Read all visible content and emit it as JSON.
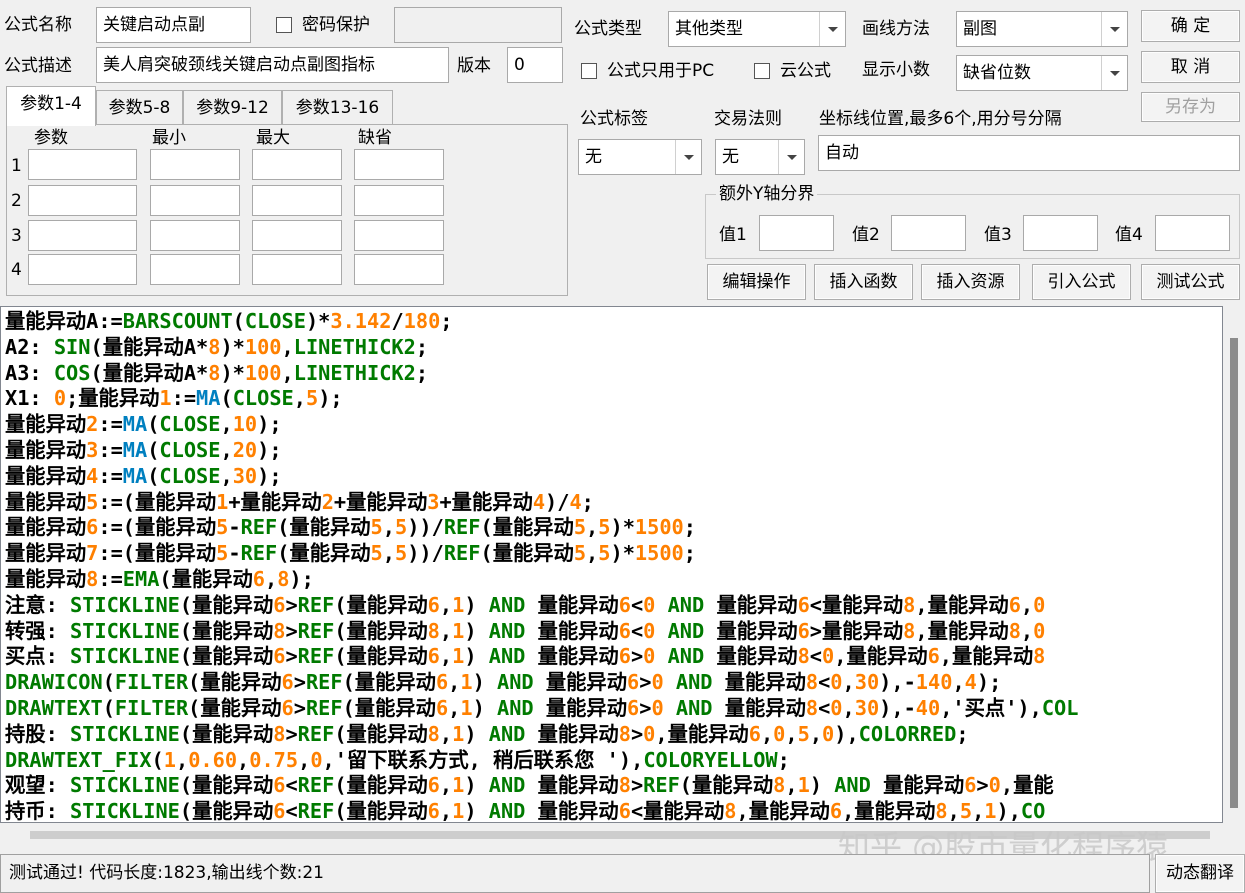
{
  "header": {
    "name_label": "公式名称",
    "name_value": "关键启动点副",
    "password_label": "密码保护",
    "password_value": "",
    "desc_label": "公式描述",
    "desc_value": "美人肩突破颈线关键启动点副图指标",
    "version_label": "版本",
    "version_value": "0",
    "type_label": "公式类型",
    "type_value": "其他类型",
    "draw_method_label": "画线方法",
    "draw_method_value": "副图",
    "pc_only_label": "公式只用于PC",
    "cloud_label": "云公式",
    "decimals_label": "显示小数",
    "decimals_value": "缺省位数"
  },
  "buttons": {
    "ok": "确  定",
    "cancel": "取  消",
    "save_as": "另存为",
    "edit_ops": "编辑操作",
    "insert_func": "插入函数",
    "insert_res": "插入资源",
    "import_formula": "引入公式",
    "test_formula": "测试公式",
    "dynamic_translate": "动态翻译"
  },
  "tabs": [
    "参数1-4",
    "参数5-8",
    "参数9-12",
    "参数13-16"
  ],
  "params": {
    "headers": [
      "参数",
      "最小",
      "最大",
      "缺省"
    ],
    "rows": [
      "1",
      "2",
      "3",
      "4"
    ]
  },
  "tags": {
    "formula_tag_label": "公式标签",
    "formula_tag_value": "无",
    "trade_rule_label": "交易法则",
    "trade_rule_value": "无",
    "coord_label": "坐标线位置,最多6个,用分号分隔",
    "coord_value": "自动"
  },
  "yaxis": {
    "group_label": "额外Y轴分界",
    "v1": "值1",
    "v2": "值2",
    "v3": "值3",
    "v4": "值4"
  },
  "code_lines": [
    "量能异动A:=BARSCOUNT(CLOSE)*3.142/180;",
    "A2: SIN(量能异动A*8)*100,LINETHICK2;",
    "A3: COS(量能异动A*8)*100,LINETHICK2;",
    "X1: 0;量能异动1:=MA(CLOSE,5);",
    "量能异动2:=MA(CLOSE,10);",
    "量能异动3:=MA(CLOSE,20);",
    "量能异动4:=MA(CLOSE,30);",
    "量能异动5:=(量能异动1+量能异动2+量能异动3+量能异动4)/4;",
    "量能异动6:=(量能异动5-REF(量能异动5,5))/REF(量能异动5,5)*1500;",
    "量能异动7:=(量能异动5-REF(量能异动5,5))/REF(量能异动5,5)*1500;",
    "量能异动8:=EMA(量能异动6,8);",
    "注意: STICKLINE(量能异动6>REF(量能异动6,1) AND 量能异动6<0 AND 量能异动6<量能异动8,量能异动6,0",
    "转强: STICKLINE(量能异动8>REF(量能异动8,1) AND 量能异动6<0 AND 量能异动6>量能异动8,量能异动8,0",
    "买点: STICKLINE(量能异动6>REF(量能异动6,1) AND 量能异动6>0 AND 量能异动8<0,量能异动6,量能异动8",
    "DRAWICON(FILTER(量能异动6>REF(量能异动6,1) AND 量能异动6>0 AND 量能异动8<0,30),-140,4);",
    "DRAWTEXT(FILTER(量能异动6>REF(量能异动6,1) AND 量能异动6>0 AND 量能异动8<0,30),-40,'买点'),COL",
    "持股: STICKLINE(量能异动8>REF(量能异动8,1) AND 量能异动8>0,量能异动6,0,5,0),COLORRED;",
    "DRAWTEXT_FIX(1,0.60,0.75,0,'留下联系方式, 稍后联系您 '),COLORYELLOW;",
    "观望: STICKLINE(量能异动6<REF(量能异动6,1) AND 量能异动8>REF(量能异动8,1) AND 量能异动6>0,量能",
    "持币: STICKLINE(量能异动6<REF(量能异动6,1) AND 量能异动6<量能异动8,量能异动6,量能异动8,5,1),CO"
  ],
  "status": {
    "text": "测试通过! 代码长度:1823,输出线个数:21"
  },
  "watermark": "知乎 @股市量化程序猿",
  "colors": {
    "keyword": "#007a00",
    "number": "#ff8000",
    "function": "#0080c0"
  }
}
